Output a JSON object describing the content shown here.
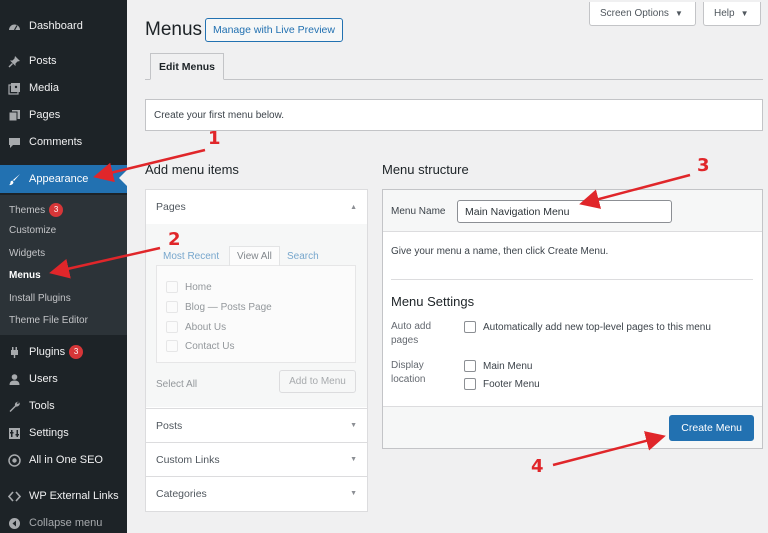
{
  "sidebar": {
    "items": [
      {
        "label": "Dashboard",
        "icon": "dashboard-icon"
      },
      {
        "label": "Posts",
        "icon": "pin-icon"
      },
      {
        "label": "Media",
        "icon": "media-icon"
      },
      {
        "label": "Pages",
        "icon": "pages-icon"
      },
      {
        "label": "Comments",
        "icon": "comments-icon"
      },
      {
        "label": "Appearance",
        "icon": "paintbrush-icon"
      },
      {
        "label": "Plugins",
        "icon": "plugins-icon",
        "badge": "3"
      },
      {
        "label": "Users",
        "icon": "users-icon"
      },
      {
        "label": "Tools",
        "icon": "wrench-icon"
      },
      {
        "label": "Settings",
        "icon": "settings-icon"
      },
      {
        "label": "All in One SEO",
        "icon": "seo-icon"
      },
      {
        "label": "WP External Links",
        "icon": "code-icon"
      },
      {
        "label": "Collapse menu",
        "icon": "collapse-icon"
      }
    ],
    "submenu": [
      {
        "label": "Themes",
        "badge": "3"
      },
      {
        "label": "Customize"
      },
      {
        "label": "Widgets"
      },
      {
        "label": "Menus"
      },
      {
        "label": "Install Plugins"
      },
      {
        "label": "Theme File Editor"
      }
    ]
  },
  "header": {
    "screen_options": "Screen Options",
    "help": "Help",
    "title": "Menus",
    "live_preview": "Manage with Live Preview",
    "tab": "Edit Menus",
    "notice": "Create your first menu below."
  },
  "add_items": {
    "title": "Add menu items",
    "pages_heading": "Pages",
    "tabs": [
      "Most Recent",
      "View All",
      "Search"
    ],
    "pages": [
      "Home",
      "Blog — Posts Page",
      "About Us",
      "Contact Us"
    ],
    "select_all": "Select All",
    "add_button": "Add to Menu",
    "sections": [
      "Posts",
      "Custom Links",
      "Categories"
    ]
  },
  "menu_structure": {
    "title": "Menu structure",
    "name_label": "Menu Name",
    "name_value": "Main Navigation Menu",
    "hint": "Give your menu a name, then click Create Menu.",
    "settings_title": "Menu Settings",
    "auto_add_label": "Auto add pages",
    "auto_add_option": "Automatically add new top-level pages to this menu",
    "display_label": "Display location",
    "locations": [
      "Main Menu",
      "Footer Menu"
    ],
    "create_button": "Create Menu"
  },
  "annotations": [
    "1",
    "2",
    "3",
    "4"
  ],
  "colors": {
    "sidebar_bg": "#1d2327",
    "accent": "#2271b1",
    "annotation": "#e0262a",
    "badge": "#d63638"
  }
}
